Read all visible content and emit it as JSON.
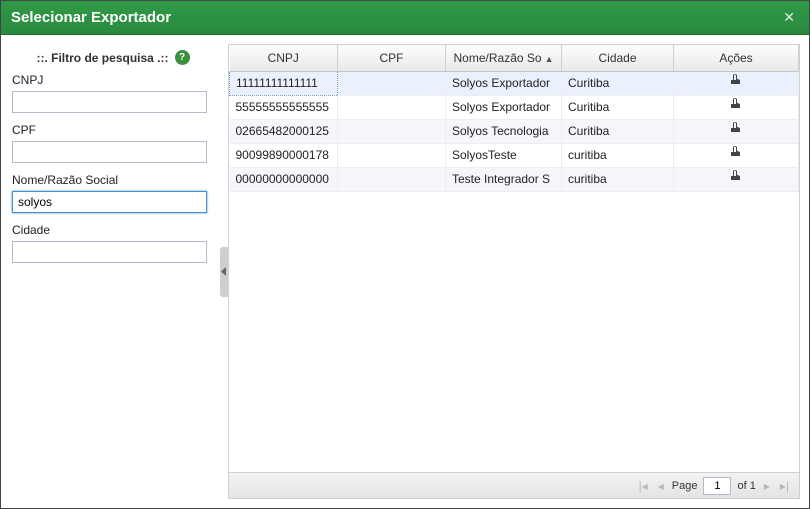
{
  "window": {
    "title": "Selecionar Exportador"
  },
  "sidebar": {
    "header": "::. Filtro de pesquisa .::",
    "fields": {
      "cnpj": {
        "label": "CNPJ",
        "value": ""
      },
      "cpf": {
        "label": "CPF",
        "value": ""
      },
      "nome": {
        "label": "Nome/Razão Social",
        "value": "solyos"
      },
      "cidade": {
        "label": "Cidade",
        "value": ""
      }
    }
  },
  "grid": {
    "columns": {
      "cnpj": "CNPJ",
      "cpf": "CPF",
      "nome": "Nome/Razão So",
      "cidade": "Cidade",
      "acoes": "Ações"
    },
    "rows": [
      {
        "cnpj": "11111111111111",
        "cpf": "",
        "nome": "Solyos Exportador",
        "cidade": "Curitiba"
      },
      {
        "cnpj": "55555555555555",
        "cpf": "",
        "nome": "Solyos Exportador",
        "cidade": "Curitiba"
      },
      {
        "cnpj": "02665482000125",
        "cpf": "",
        "nome": "Solyos Tecnologia",
        "cidade": "Curitiba"
      },
      {
        "cnpj": "90099890000178",
        "cpf": "",
        "nome": "SolyosTeste",
        "cidade": "curitiba"
      },
      {
        "cnpj": "00000000000000",
        "cpf": "",
        "nome": "Teste Integrador S",
        "cidade": "curitiba"
      }
    ]
  },
  "pager": {
    "page_label": "Page",
    "page_value": "1",
    "of_label": "of 1"
  }
}
